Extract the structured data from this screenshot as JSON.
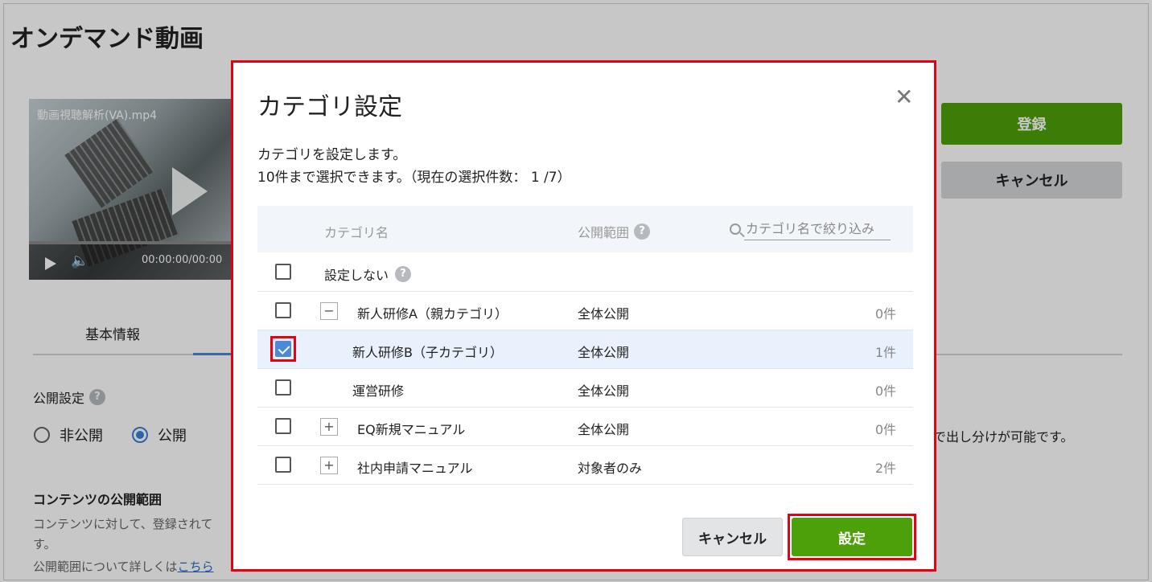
{
  "page": {
    "title": "オンデマンド動画",
    "register_label": "登録",
    "cancel_label": "キャンセル",
    "tab_basic": "基本情報",
    "publish_setting_label": "公開設定",
    "radio_private": "非公開",
    "radio_public": "公開",
    "right_note": "で出し分けが可能です。",
    "scope_title": "コンテンツの公開範囲",
    "scope_desc1": "コンテンツに対して、登録されて",
    "scope_desc2": "す。",
    "scope_desc3_prefix": "公開範囲について詳しくは",
    "scope_link": "こちら"
  },
  "video": {
    "filename": "動画視聴解析(VA).mp4",
    "time": "00:00:00/00:00"
  },
  "modal": {
    "title": "カテゴリ設定",
    "desc1": "カテゴリを設定します。",
    "desc2": "10件まで選択できます。（現在の選択件数： 1 /7）",
    "col_name": "カテゴリ名",
    "col_scope": "公開範囲",
    "search_placeholder": "カテゴリ名で絞り込み",
    "row_none": "設定しない",
    "rows": [
      {
        "name": "新人研修A（親カテゴリ）",
        "scope": "全体公開",
        "count": "0件",
        "toggle": "−",
        "checked": false
      },
      {
        "name": "新人研修B（子カテゴリ）",
        "scope": "全体公開",
        "count": "1件",
        "toggle": "",
        "checked": true
      },
      {
        "name": "運営研修",
        "scope": "全体公開",
        "count": "0件",
        "toggle": "",
        "checked": false
      },
      {
        "name": "EQ新規マニュアル",
        "scope": "全体公開",
        "count": "0件",
        "toggle": "+",
        "checked": false
      },
      {
        "name": "社内申請マニュアル",
        "scope": "対象者のみ",
        "count": "2件",
        "toggle": "+",
        "checked": false
      }
    ],
    "cancel_label": "キャンセル",
    "set_label": "設定"
  },
  "colors": {
    "accent_green": "#4ea00a",
    "highlight_red": "#e60012",
    "check_blue": "#4a8ad6"
  }
}
